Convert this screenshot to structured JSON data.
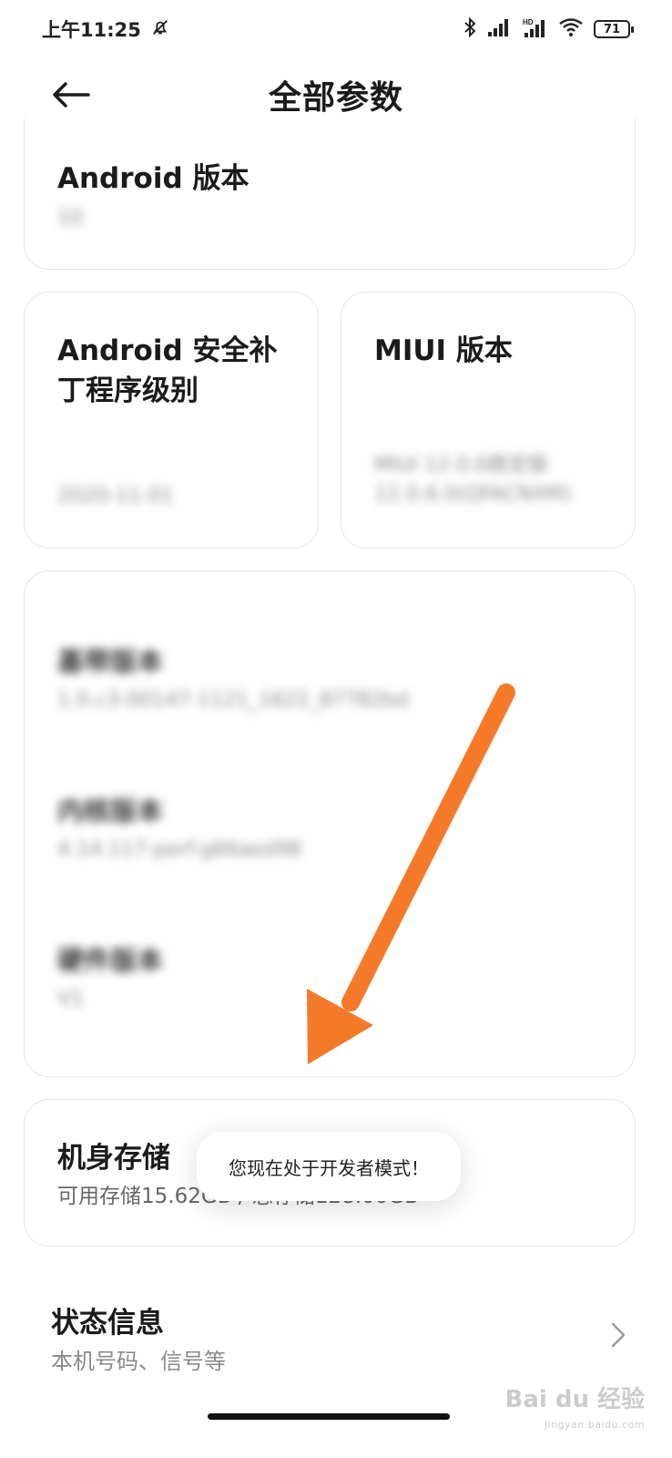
{
  "status_bar": {
    "time": "上午11:25",
    "battery": "71",
    "icons": [
      "mute-bell-icon",
      "bluetooth-icon",
      "signal-icon",
      "hd-signal-icon",
      "wifi-icon",
      "battery-icon"
    ]
  },
  "header": {
    "title": "全部参数",
    "back_icon": "back-arrow-icon"
  },
  "cards": {
    "android_version": {
      "title": "Android 版本",
      "value": "10"
    },
    "security_patch": {
      "title_line1": "Android 安全补",
      "title_line2": "丁程序级别",
      "value": "2020-11-01"
    },
    "miui_version": {
      "title": "MIUI 版本",
      "value_line1": "MIUI 12.0.6稳定版",
      "value_line2": "12.0.6.0(QFACNXM)"
    },
    "versions": [
      {
        "label": "基带版本",
        "value": "1.0.c3-00147-1121_1622_87782bd"
      },
      {
        "label": "内核版本",
        "value": "4.14.117-perf-g66aed98"
      },
      {
        "label": "硬件版本",
        "value": "V1"
      }
    ],
    "storage": {
      "title": "机身存储",
      "value": "可用存储15.62GB / 总存储128.00GB"
    }
  },
  "status_info": {
    "title": "状态信息",
    "subtitle": "本机号码、信号等"
  },
  "toast": {
    "message": "您现在处于开发者模式！"
  },
  "watermark": {
    "brand": "Bai du 经验",
    "url": "jingyan.baidu.com"
  },
  "colors": {
    "annotation_arrow": "#f47a2a",
    "text_primary": "#1b1b1b",
    "text_secondary": "#8a8a8a"
  }
}
